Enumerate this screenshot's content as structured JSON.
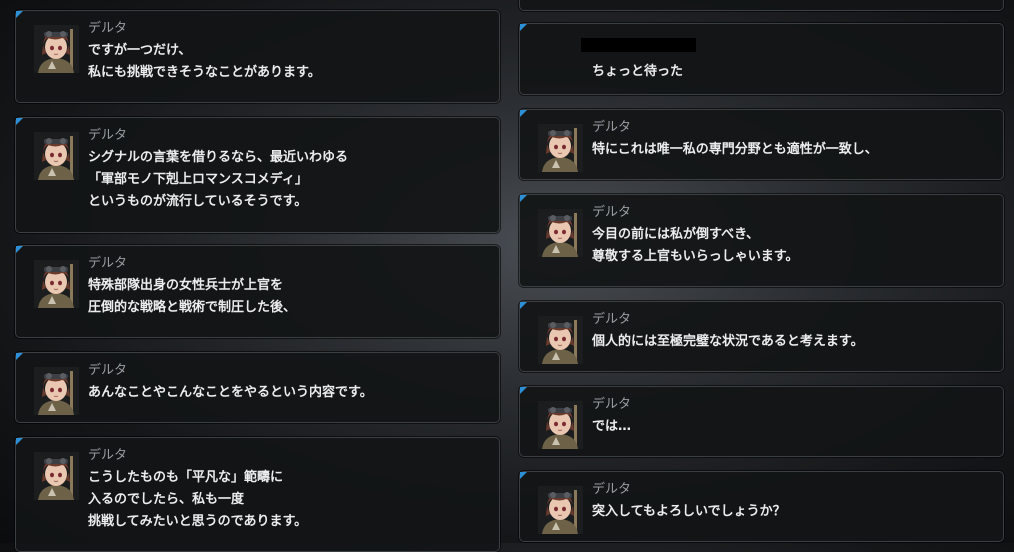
{
  "left_messages": [
    {
      "speaker": "デルタ",
      "lines": [
        "ですが一つだけ、",
        "私にも挑戦できそうなことがあります。"
      ]
    },
    {
      "speaker": "デルタ",
      "lines": [
        "シグナルの言葉を借りるなら、最近いわゆる",
        "「軍部モノ下剋上ロマンスコメディ」",
        "というものが流行しているそうです。"
      ]
    },
    {
      "speaker": "デルタ",
      "lines": [
        "特殊部隊出身の女性兵士が上官を",
        "圧倒的な戦略と戦術で制圧した後、"
      ]
    },
    {
      "speaker": "デルタ",
      "lines": [
        "あんなことやこんなことをやるという内容です。"
      ]
    },
    {
      "speaker": "デルタ",
      "lines": [
        "こうしたものも「平凡な」範疇に",
        "入るのでしたら、私も一度",
        "挑戦してみたいと思うのであります。"
      ]
    }
  ],
  "right_messages": [
    {
      "speaker": "",
      "lines": []
    },
    {
      "speaker": "",
      "lines": [
        "ちょっと待った"
      ]
    },
    {
      "speaker": "デルタ",
      "lines": [
        "特にこれは唯一私の専門分野とも適性が一致し、"
      ]
    },
    {
      "speaker": "デルタ",
      "lines": [
        "今目の前には私が倒すべき、",
        "尊敬する上官もいらっしゃいます。"
      ]
    },
    {
      "speaker": "デルタ",
      "lines": [
        "個人的には至極完璧な状況であると考えます。"
      ]
    },
    {
      "speaker": "デルタ",
      "lines": [
        "では…"
      ]
    },
    {
      "speaker": "デルタ",
      "lines": [
        "突入してもよろしいでしょうか？"
      ]
    }
  ],
  "colors": {
    "accent": "#2d8fd6",
    "bubble_bg": "#121416",
    "text": "#ecedee",
    "speaker": "#9a9fa4"
  },
  "icons": {
    "avatar": "delta-avatar-icon"
  }
}
